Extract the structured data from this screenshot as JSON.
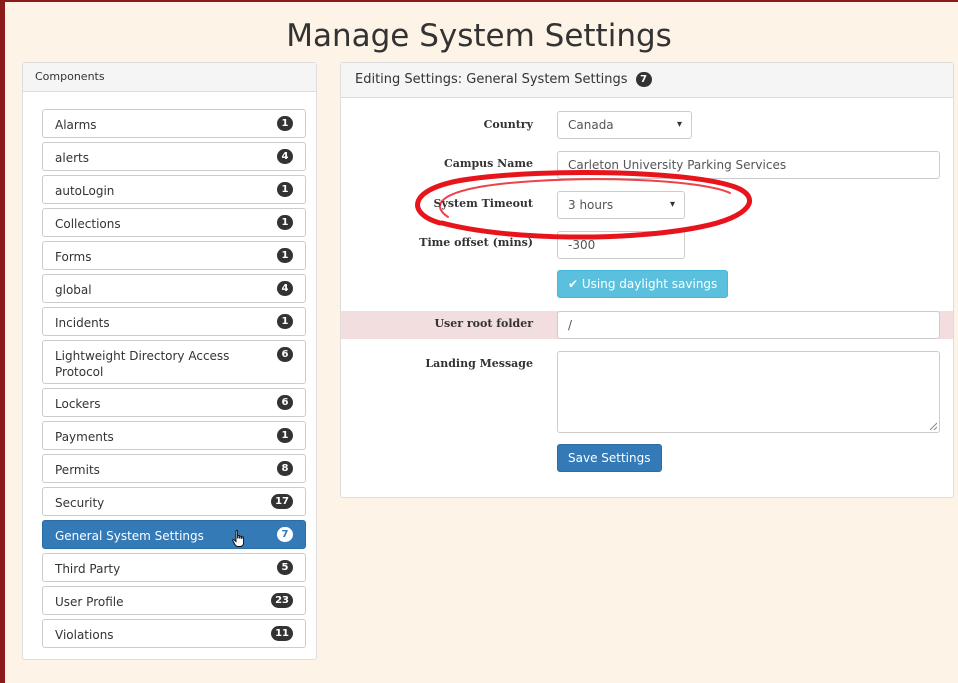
{
  "page": {
    "title": "Manage System Settings"
  },
  "components": {
    "heading": "Components",
    "items": [
      {
        "label": "Alarms",
        "count": "1"
      },
      {
        "label": "alerts",
        "count": "4"
      },
      {
        "label": "autoLogin",
        "count": "1"
      },
      {
        "label": "Collections",
        "count": "1"
      },
      {
        "label": "Forms",
        "count": "1"
      },
      {
        "label": "global",
        "count": "4"
      },
      {
        "label": "Incidents",
        "count": "1"
      },
      {
        "label": "Lightweight Directory Access Protocol",
        "count": "6"
      },
      {
        "label": "Lockers",
        "count": "6"
      },
      {
        "label": "Payments",
        "count": "1"
      },
      {
        "label": "Permits",
        "count": "8"
      },
      {
        "label": "Security",
        "count": "17"
      },
      {
        "label": "General System Settings",
        "count": "7",
        "active": true
      },
      {
        "label": "Third Party",
        "count": "5"
      },
      {
        "label": "User Profile",
        "count": "23"
      },
      {
        "label": "Violations",
        "count": "11"
      }
    ]
  },
  "editor": {
    "heading": "Editing Settings: General System Settings",
    "count": "7",
    "fields": {
      "country": {
        "label": "Country",
        "value": "Canada"
      },
      "campus_name": {
        "label": "Campus Name",
        "value": "Carleton University Parking Services"
      },
      "system_timeout": {
        "label": "System Timeout",
        "value": "3 hours"
      },
      "time_offset": {
        "label": "Time offset (mins)",
        "value": "-300"
      },
      "daylight_button": "Using daylight savings",
      "user_root_folder": {
        "label": "User root folder",
        "value": "/"
      },
      "landing_message": {
        "label": "Landing Message",
        "value": ""
      }
    },
    "save_label": "Save Settings"
  },
  "colors": {
    "primary": "#337ab7",
    "info": "#5bc0de",
    "highlight_row": "#f2dede",
    "annotation": "#e8141b",
    "frame": "#8b1a1a"
  }
}
